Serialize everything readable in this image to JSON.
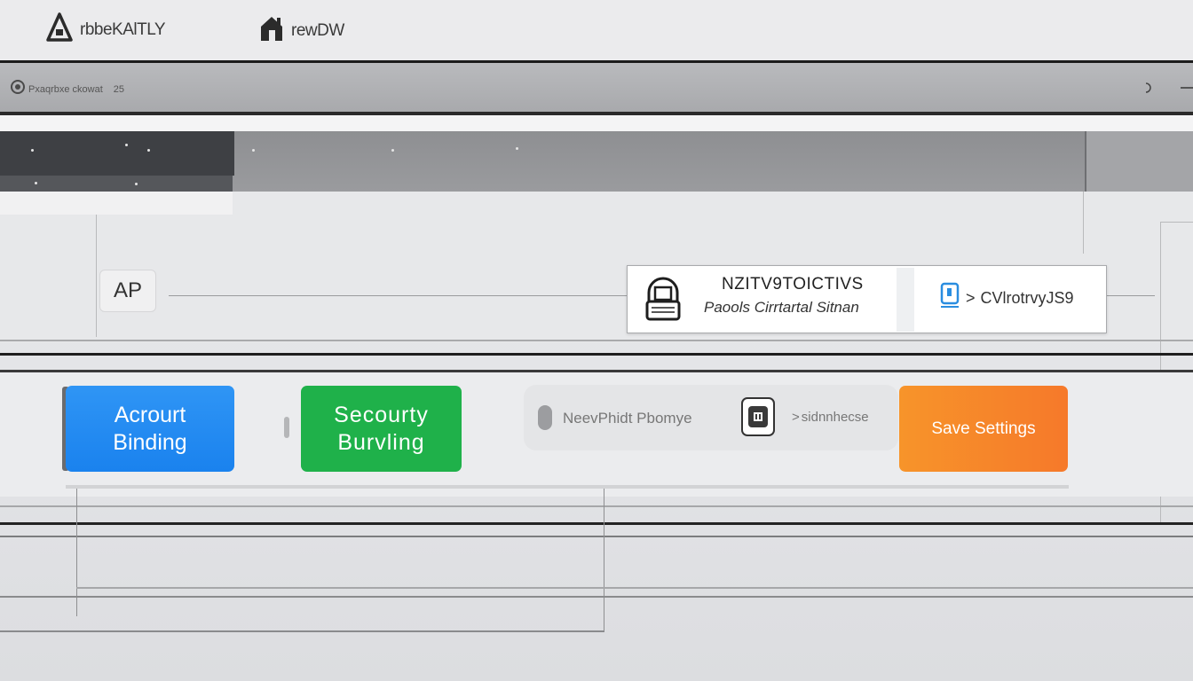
{
  "window": {
    "brand_primary": "rbbeKAlTLY",
    "brand_secondary": "rewDW",
    "address_text": "Pxaqrbxe ckowat",
    "address_badge": "25"
  },
  "panel": {
    "ap_label": "AP",
    "card": {
      "title": "NZITV9TOICTIVS",
      "subtitle": "Paools Cirrtartal Sitnan",
      "link_arrow": ">",
      "link_label": "CVlrotrvyJS9"
    }
  },
  "actions": {
    "account_binding": {
      "line1": "Acrourt",
      "line2": "Binding"
    },
    "security_binding": {
      "line1": "Secourty",
      "line2": "Burvling"
    },
    "privacy_text": "NeevPhidt Pbomye",
    "sidebar_link_arrow": ">",
    "sidebar_link_text": "sidnnhecse",
    "save_label": "Save Settings"
  },
  "colors": {
    "account_button": "#2f95f5",
    "security_button": "#1fb14a",
    "save_button": "#f6792a",
    "link_icon": "#2a8de0"
  },
  "icons": {
    "brand": "warning-triangle-icon",
    "secondary": "home-icon",
    "address": "globe-icon",
    "card": "printer-icon",
    "link": "document-icon",
    "chip": "sim-card-icon"
  }
}
